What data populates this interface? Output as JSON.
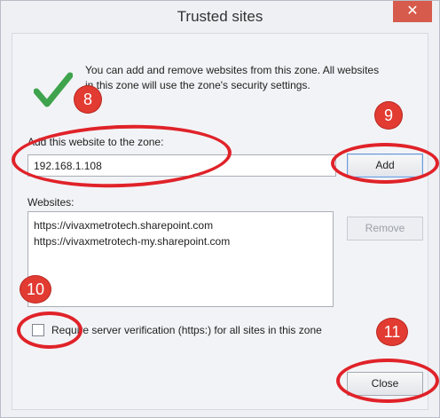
{
  "window": {
    "title": "Trusted sites",
    "close_glyph": "✕"
  },
  "info": {
    "icon": "checkmark-icon",
    "line1": "You can add and remove websites from this zone. All websites",
    "line2": "in this zone will use the zone's security settings."
  },
  "add_site": {
    "label": "Add this website to the zone:",
    "value": "192.168.1.108",
    "add_button": "Add"
  },
  "websites": {
    "label": "Websites:",
    "items": [
      "https://vivaxmetrotech.sharepoint.com",
      "https://vivaxmetrotech-my.sharepoint.com"
    ],
    "remove_button": "Remove"
  },
  "require_https": {
    "label": "Require server verification (https:) for all sites in this zone",
    "checked": false
  },
  "close_button": "Close",
  "annotations": {
    "badge_8": "8",
    "badge_9": "9",
    "badge_10": "10",
    "badge_11": "11",
    "color": "#e02229"
  }
}
